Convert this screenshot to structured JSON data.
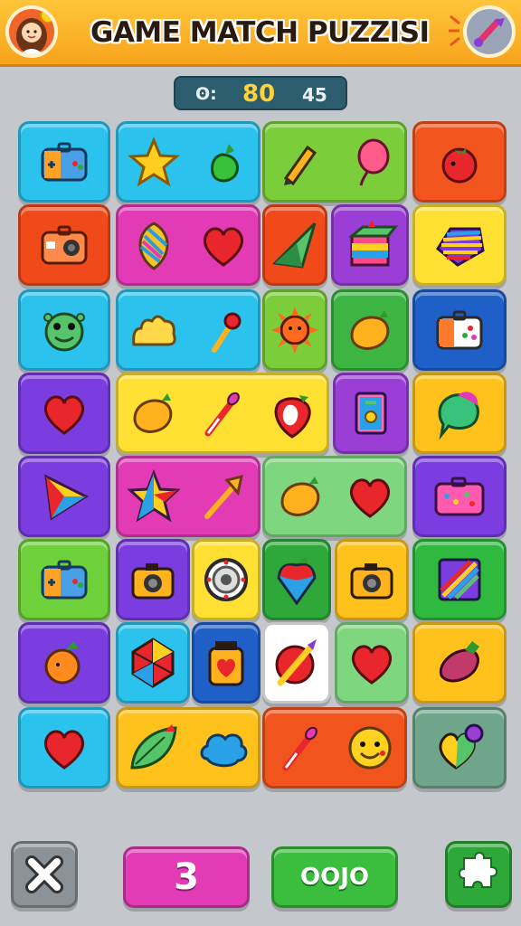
{
  "header": {
    "title": "GAME MATCH PUZZISI",
    "avatar_icon": "girl-avatar-icon",
    "settings_icon": "brush-settings-icon"
  },
  "scorebar": {
    "label": "ʘ:",
    "score": "80",
    "moves": "45"
  },
  "board": {
    "rows": [
      [
        {
          "color": "#2bc3ee",
          "icons": [
            "gamepad-case-icon"
          ]
        },
        {
          "color": "#2bc3ee",
          "icons": [
            "star-icon",
            "radish-icon"
          ]
        },
        {
          "color": "#7ccd3a",
          "icons": [
            "pencil-icon",
            "balloon-icon"
          ]
        },
        {
          "color": "#f2541e",
          "icons": [
            "tomato-icon"
          ]
        }
      ],
      [
        {
          "color": "#f04a1a",
          "icons": [
            "camera-case-icon"
          ]
        },
        {
          "color": "#e23bb5",
          "icons": [
            "leaf-gem-icon",
            "heart-icon"
          ]
        },
        {
          "color": "#f04a1a",
          "icons": [
            "kite-gem-icon"
          ]
        },
        {
          "color": "#9a3ed6",
          "icons": [
            "rainbow-box-icon"
          ]
        },
        {
          "color": "#ffe033",
          "icons": [
            "rainbow-gem-icon"
          ]
        }
      ],
      [
        {
          "color": "#2bc3ee",
          "icons": [
            "frog-icon"
          ]
        },
        {
          "color": "#2bc3ee",
          "icons": [
            "crown-icon",
            "lollipop-icon"
          ]
        },
        {
          "color": "#7ccd3a",
          "icons": [
            "sun-icon"
          ]
        },
        {
          "color": "#3cb542",
          "icons": [
            "mango-icon"
          ]
        },
        {
          "color": "#1f5fc8",
          "icons": [
            "toolbox-icon"
          ]
        }
      ],
      [
        {
          "color": "#7b3de0",
          "icons": [
            "heart-icon"
          ]
        },
        {
          "color": "#ffe033",
          "icons": [
            "mango-icon",
            "paintbrush-icon",
            "strawberry-icon"
          ]
        },
        {
          "color": "#9a3ed6",
          "icons": [
            "card-icon"
          ]
        },
        {
          "color": "#ffc21c",
          "icons": [
            "chat-leaf-icon"
          ]
        }
      ],
      [
        {
          "color": "#7b3de0",
          "icons": [
            "triangle-gem-icon"
          ]
        },
        {
          "color": "#e23bb5",
          "icons": [
            "star-gem-icon",
            "arrow-icon"
          ]
        },
        {
          "color": "#7ed67f",
          "icons": [
            "mango-icon",
            "heart-icon"
          ]
        },
        {
          "color": "#7b3de0",
          "icons": [
            "palette-case-icon"
          ]
        }
      ],
      [
        {
          "color": "#6ed03a",
          "icons": [
            "gamepad-case-icon"
          ]
        },
        {
          "color": "#7b3de0",
          "icons": [
            "camera-icon"
          ]
        },
        {
          "color": "#ffe033",
          "icons": [
            "dial-icon"
          ]
        },
        {
          "color": "#2fa83a",
          "icons": [
            "berry-cone-icon"
          ]
        },
        {
          "color": "#ffc21c",
          "icons": [
            "camera-icon"
          ]
        },
        {
          "color": "#2fb93f",
          "icons": [
            "rainbow-square-icon"
          ]
        }
      ],
      [
        {
          "color": "#7b3de0",
          "icons": [
            "orange-icon"
          ]
        },
        {
          "color": "#2bc3ee",
          "icons": [
            "polygon-gem-icon"
          ]
        },
        {
          "color": "#1f5fc8",
          "icons": [
            "heart-jar-icon"
          ]
        },
        {
          "color": "#ffffff",
          "icons": [
            "brush-disc-icon"
          ]
        },
        {
          "color": "#7ed67f",
          "icons": [
            "heart-icon"
          ]
        },
        {
          "color": "#ffc21c",
          "icons": [
            "eggplant-icon"
          ]
        }
      ],
      [
        {
          "color": "#2bc3ee",
          "icons": [
            "heart-icon"
          ]
        },
        {
          "color": "#ffc21c",
          "icons": [
            "leaf-icon",
            "cloud-icon"
          ]
        },
        {
          "color": "#f2541e",
          "icons": [
            "paintbrush-icon",
            "smiley-icon"
          ]
        },
        {
          "color": "#6fa58a",
          "icons": [
            "heart-ball-icon"
          ]
        }
      ]
    ]
  },
  "footer": {
    "close_icon": "close-icon",
    "count_label": "3",
    "ok_label": "OOJO",
    "puzzle_icon": "puzzle-piece-icon"
  },
  "colors": {
    "topbar": "#f7a41c",
    "background": "#c4c8cc",
    "scorebar": "#2c5d6e"
  }
}
